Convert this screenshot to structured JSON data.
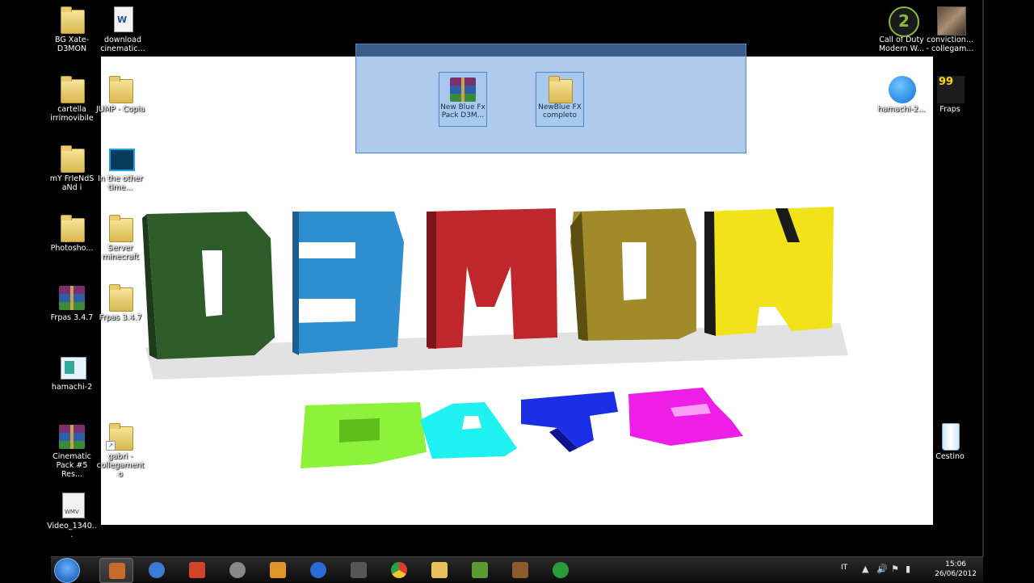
{
  "desktop": {
    "left_column": [
      {
        "label": "BG Xate-D3MON",
        "icon": "folder-icon"
      },
      {
        "label": "cartella irrimovibile",
        "icon": "folder-icon"
      },
      {
        "label": "mY FrIeNdS aNd i",
        "icon": "folder-icon"
      },
      {
        "label": "Photosho...",
        "icon": "folder-icon"
      },
      {
        "label": "Frpas 3.4.7",
        "icon": "winrar-icon"
      },
      {
        "label": "hamachi-2",
        "icon": "hamachi-icon"
      },
      {
        "label": "Cinematic Pack #5 Res...",
        "icon": "winrar-icon"
      },
      {
        "label": "Video_1340...",
        "icon": "video-file-icon"
      }
    ],
    "second_column": [
      {
        "label": "download cinematic...",
        "icon": "document-icon"
      },
      {
        "label": "JUMP - Copia",
        "icon": "folder-icon"
      },
      {
        "label": "In the other time...",
        "icon": "video-file-icon"
      },
      {
        "label": "Server minecraft",
        "icon": "folder-icon"
      },
      {
        "label": "Frpas 3.4.7",
        "icon": "folder-icon"
      },
      {
        "label": "gabri - collegamento",
        "icon": "folder-shortcut-icon"
      }
    ],
    "right_column": [
      {
        "label": "Call of Duty Modern W...",
        "icon": "cod-icon"
      },
      {
        "label": "conviction... - collegam...",
        "icon": "game-photo-icon"
      },
      {
        "label": "hamachi-2...",
        "icon": "hamachi-globe-icon"
      },
      {
        "label": "Fraps",
        "icon": "fraps-icon"
      },
      {
        "label": "Cestino",
        "icon": "recycle-bin-icon"
      }
    ],
    "selected_items": [
      {
        "label": "New Blue Fx Pack D3M...",
        "icon": "winrar-icon"
      },
      {
        "label": "NewBlue FX completo",
        "icon": "folder-icon"
      }
    ]
  },
  "wallpaper": {
    "line1": "D3MON",
    "line2": "XATE",
    "line1_colors": [
      "#2f5d2a",
      "#2e8fd0",
      "#c0272d",
      "#a08a2a",
      "#f2e21a"
    ],
    "line2_colors": [
      "#8df23a",
      "#1ff0f0",
      "#1a2ee6",
      "#ee1ee6"
    ]
  },
  "taskbar": {
    "start_label": "Start",
    "pinned": [
      {
        "name": "sourcemod-icon",
        "color": "#c86a2a"
      },
      {
        "name": "eye-icon",
        "color": "#3a7bd5"
      },
      {
        "name": "ie-addon-icon",
        "color": "#d0442a"
      },
      {
        "name": "media-center-icon",
        "color": "#888888"
      },
      {
        "name": "media-player-icon",
        "color": "#e0952a"
      },
      {
        "name": "globe-app-icon",
        "color": "#2a6cd5"
      },
      {
        "name": "video-app-icon",
        "color": "#555555"
      },
      {
        "name": "chrome-icon",
        "color": "#e03c2a"
      },
      {
        "name": "explorer-icon",
        "color": "#e8c35a"
      },
      {
        "name": "minecraft-icon",
        "color": "#5a9b35"
      },
      {
        "name": "rar-app-icon",
        "color": "#8a5a2a"
      },
      {
        "name": "utorrent-icon",
        "color": "#2a9b3a"
      }
    ],
    "tray": {
      "language": "IT",
      "time": "15:06",
      "date": "26/06/2012"
    }
  }
}
